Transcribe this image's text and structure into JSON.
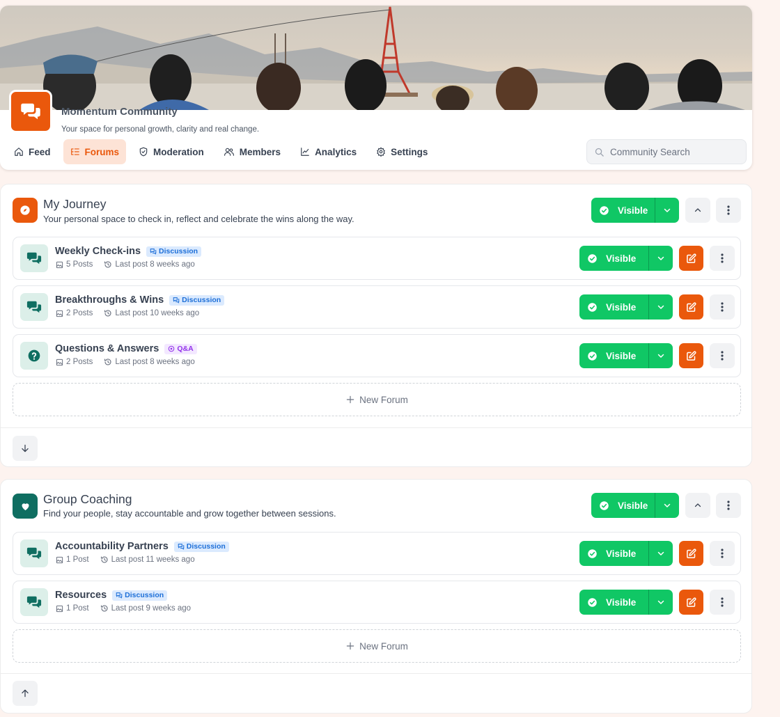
{
  "community": {
    "name": "Momentum Community",
    "tagline": "Your space for personal growth, clarity and real change."
  },
  "nav": {
    "feed": "Feed",
    "forums": "Forums",
    "moderation": "Moderation",
    "members": "Members",
    "analytics": "Analytics",
    "settings": "Settings",
    "active": "Forums"
  },
  "search": {
    "placeholder": "Community Search"
  },
  "icons": {
    "logo": "chat-bubbles-icon",
    "journey": "compass-icon",
    "coaching": "heart-icon",
    "discussion_forum": "chat-bubbles-icon",
    "qa_forum": "question-circle-icon",
    "posts": "image-icon",
    "last_post": "history-icon"
  },
  "colors": {
    "accent": "#ea580c",
    "visible_green": "#10c765",
    "teal": "#0f6e61",
    "background": "#fdf3ef"
  },
  "sections": [
    {
      "title": "My Journey",
      "description": "Your personal space to check in, reflect and celebrate the wins along the way.",
      "visibility": "Visible",
      "forums": [
        {
          "title": "Weekly Check-ins",
          "type": "Discussion",
          "posts": "5 Posts",
          "last_post": "Last post 8 weeks ago",
          "visibility": "Visible"
        },
        {
          "title": "Breakthroughs & Wins",
          "type": "Discussion",
          "posts": "2 Posts",
          "last_post": "Last post 10 weeks ago",
          "visibility": "Visible"
        },
        {
          "title": "Questions & Answers",
          "type": "Q&A",
          "posts": "2 Posts",
          "last_post": "Last post 8 weeks ago",
          "visibility": "Visible"
        }
      ],
      "new_forum_label": "New Forum"
    },
    {
      "title": "Group Coaching",
      "description": "Find your people, stay accountable and grow together between sessions.",
      "visibility": "Visible",
      "forums": [
        {
          "title": "Accountability Partners",
          "type": "Discussion",
          "posts": "1 Post",
          "last_post": "Last post 11 weeks ago",
          "visibility": "Visible"
        },
        {
          "title": "Resources",
          "type": "Discussion",
          "posts": "1 Post",
          "last_post": "Last post 9 weeks ago",
          "visibility": "Visible"
        }
      ],
      "new_forum_label": "New Forum"
    }
  ]
}
